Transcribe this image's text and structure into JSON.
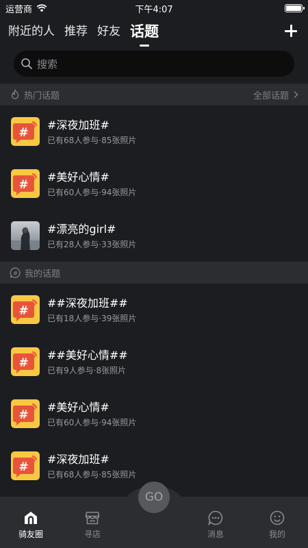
{
  "status_bar": {
    "carrier": "运营商",
    "time": "下午4:07"
  },
  "nav": {
    "tabs": [
      {
        "label": "附近的人",
        "active": false
      },
      {
        "label": "推荐",
        "active": false
      },
      {
        "label": "好友",
        "active": false
      },
      {
        "label": "话题",
        "active": true
      }
    ],
    "add_icon": "plus-icon"
  },
  "search": {
    "placeholder": "搜索"
  },
  "hot_section": {
    "title": "热门话题",
    "more_label": "全部话题",
    "items": [
      {
        "title": "#深夜加班#",
        "meta": "已有68人参与·85张照片",
        "icon": "topic-icon"
      },
      {
        "title": "#美好心情#",
        "meta": "已有60人参与·94张照片",
        "icon": "topic-icon"
      },
      {
        "title": "#漂亮的girl#",
        "meta": "已有28人参与·33张照片",
        "icon": "photo-thumbnail"
      }
    ]
  },
  "my_section": {
    "title": "我的话题",
    "items": [
      {
        "title": "##深夜加班##",
        "meta": "已有18人参与·39张照片"
      },
      {
        "title": "##美好心情##",
        "meta": "已有9人参与·8张照片"
      },
      {
        "title": "#美好心情#",
        "meta": "已有60人参与·94张照片"
      },
      {
        "title": "#深夜加班#",
        "meta": "已有68人参与·85张照片"
      }
    ]
  },
  "tab_bar": {
    "items": [
      {
        "label": "骑友圈",
        "active": true
      },
      {
        "label": "寻店",
        "active": false
      },
      {
        "label": "消息",
        "active": false
      },
      {
        "label": "我的",
        "active": false
      }
    ],
    "go_label": "GO"
  },
  "colors": {
    "background": "#1c1d20",
    "section_bg": "#2b2d31",
    "icon_yellow": "#f9c843",
    "icon_red": "#e8543a"
  }
}
